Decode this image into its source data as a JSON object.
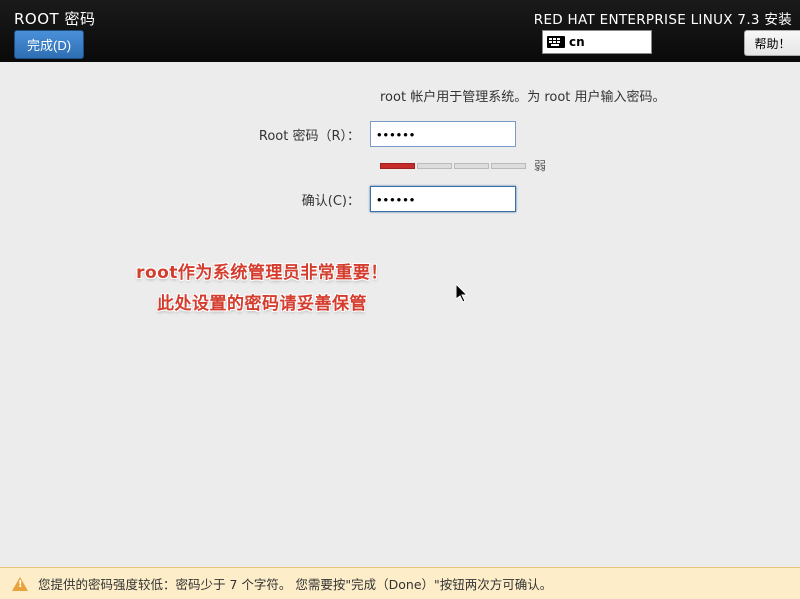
{
  "header": {
    "title": "ROOT 密码",
    "done_label": "完成(D)",
    "product": "RED HAT ENTERPRISE LINUX 7.3 安装",
    "keyboard_layout": "cn",
    "help_label": "帮助！"
  },
  "form": {
    "instruction": "root 帐户用于管理系统。为 root 用户输入密码。",
    "password_label": "Root 密码（R）：",
    "password_value": "••••••",
    "confirm_label": "确认(C)：",
    "confirm_value": "••••••",
    "strength_text": "弱",
    "strength_segments": 4,
    "strength_filled": 1
  },
  "annotation": {
    "line1": "root作为系统管理员非常重要！",
    "line2": "此处设置的密码请妥善保管"
  },
  "warning": {
    "message": "您提供的密码强度较低：密码少于 7 个字符。 您需要按\"完成（Done）\"按钮两次方可确认。"
  },
  "colors": {
    "accent": "#3a6ea5",
    "warn_bg": "#fdedc8",
    "danger": "#c72c2c",
    "anno": "#d43c2e"
  }
}
